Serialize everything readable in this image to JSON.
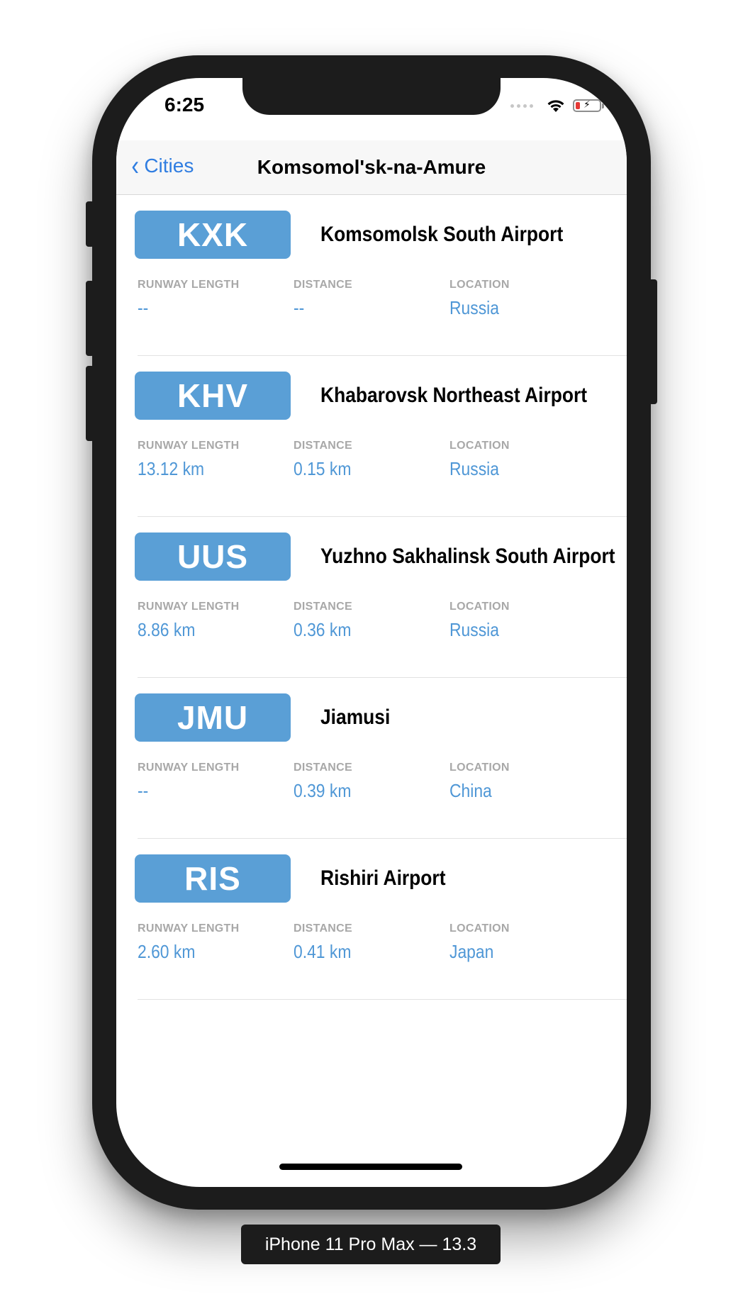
{
  "status_bar": {
    "time": "6:25"
  },
  "nav": {
    "back_label": "Cities",
    "title": "Komsomol'sk-na-Amure"
  },
  "labels": {
    "runway": "RUNWAY LENGTH",
    "distance": "DISTANCE",
    "location": "LOCATION"
  },
  "airports": [
    {
      "code": "KXK",
      "name": "Komsomolsk South Airport",
      "runway": "--",
      "distance": "--",
      "location": "Russia"
    },
    {
      "code": "KHV",
      "name": "Khabarovsk Northeast Airport",
      "runway": "13.12 km",
      "distance": "0.15 km",
      "location": "Russia"
    },
    {
      "code": "UUS",
      "name": "Yuzhno Sakhalinsk South Airport",
      "runway": "8.86 km",
      "distance": "0.36 km",
      "location": "Russia"
    },
    {
      "code": "JMU",
      "name": "Jiamusi",
      "runway": "--",
      "distance": "0.39 km",
      "location": "China"
    },
    {
      "code": "RIS",
      "name": "Rishiri Airport",
      "runway": "2.60 km",
      "distance": "0.41 km",
      "location": "Japan"
    }
  ],
  "device_label": "iPhone 11 Pro Max — 13.3",
  "colors": {
    "accent": "#2f7de1",
    "badge": "#5a9fd6",
    "value": "#4f97d6",
    "label": "#a8a8a8"
  }
}
